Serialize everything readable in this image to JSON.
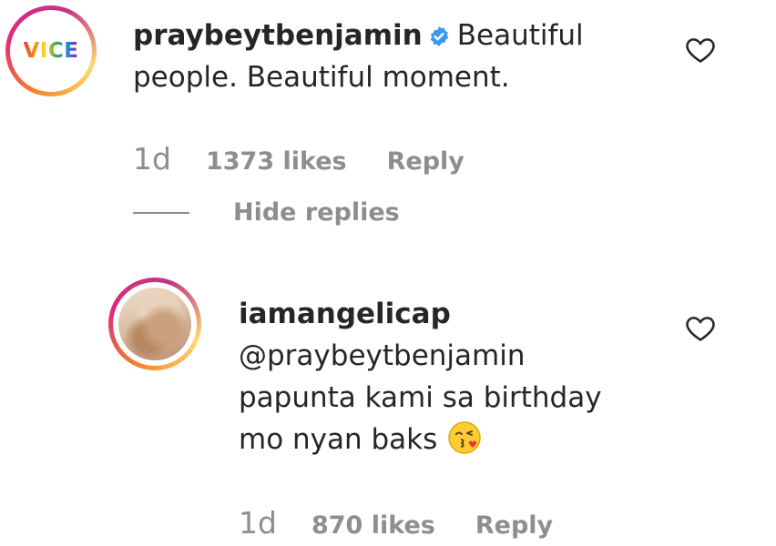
{
  "comment": {
    "avatar_text": "VICE",
    "username": "praybeytbenjamin",
    "text_line1": "Beautiful",
    "text_line2": "people. Beautiful moment.",
    "time": "1d",
    "likes": "1373 likes",
    "reply_label": "Reply",
    "hide_replies_label": "Hide replies"
  },
  "reply": {
    "username": "iamangelicap",
    "line1": "@praybeytbenjamin",
    "line2": "papunta kami sa birthday",
    "line3": "mo nyan baks",
    "time": "1d",
    "likes": "870 likes",
    "reply_label": "Reply"
  },
  "colors": {
    "text": "#262626",
    "muted": "#8e8e8e",
    "verified": "#3897f0"
  },
  "icons": [
    "verified-badge-icon",
    "heart-icon",
    "kissing-emoji-icon"
  ]
}
